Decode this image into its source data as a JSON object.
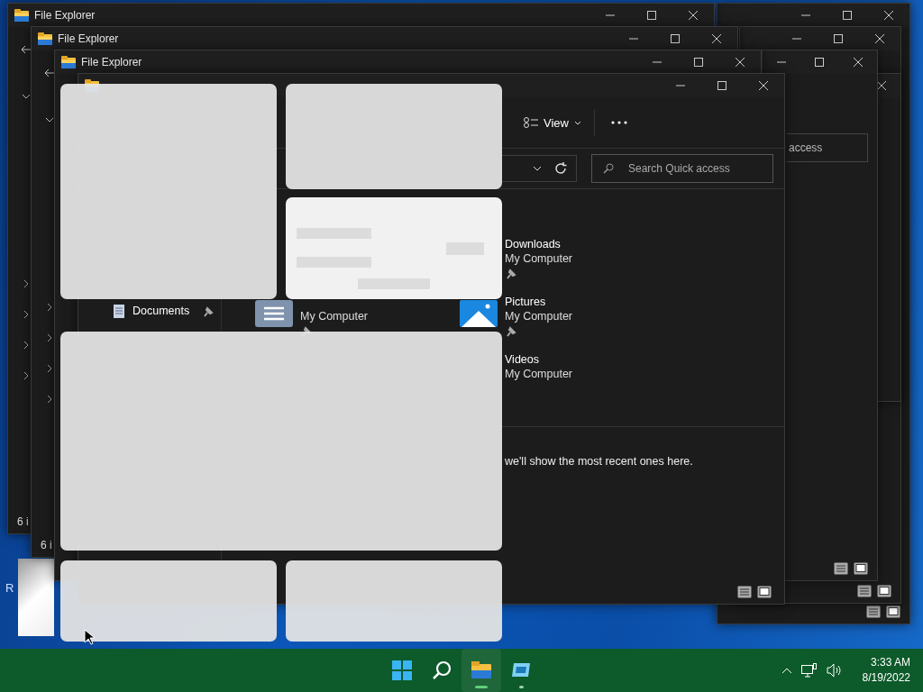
{
  "desktop": {
    "icon_label": "R"
  },
  "background_windows": [
    {
      "title": "File Explorer",
      "status": "6 i"
    },
    {
      "title": "File Explorer",
      "status": "6 i"
    },
    {
      "title": "File Explorer"
    }
  ],
  "side_window": {
    "search_text": "access"
  },
  "front_window": {
    "toolbar": {
      "view_label": "View"
    },
    "search": {
      "placeholder": "Search Quick access"
    },
    "sidebar": {
      "items": [
        {
          "label": "Documents",
          "pinned": true
        }
      ]
    },
    "tiles": [
      {
        "kind": "documents",
        "location": "My Computer",
        "pinned": true
      },
      {
        "kind": "downloads",
        "name": "Downloads",
        "location": "My Computer",
        "pinned": true
      },
      {
        "kind": "pictures",
        "name": "Pictures",
        "location": "My Computer",
        "pinned": true
      },
      {
        "kind": "videos",
        "name": "Videos",
        "location": "My Computer",
        "pinned": false
      }
    ],
    "message": "we'll show the most recent ones here."
  },
  "taskbar": {
    "items": [
      {
        "kind": "start",
        "running": false,
        "active": false
      },
      {
        "kind": "search",
        "running": false,
        "active": false
      },
      {
        "kind": "explorer",
        "running": true,
        "active": true
      },
      {
        "kind": "app",
        "running": true,
        "active": false
      }
    ],
    "time": "3:33 AM",
    "date": "8/19/2022"
  }
}
